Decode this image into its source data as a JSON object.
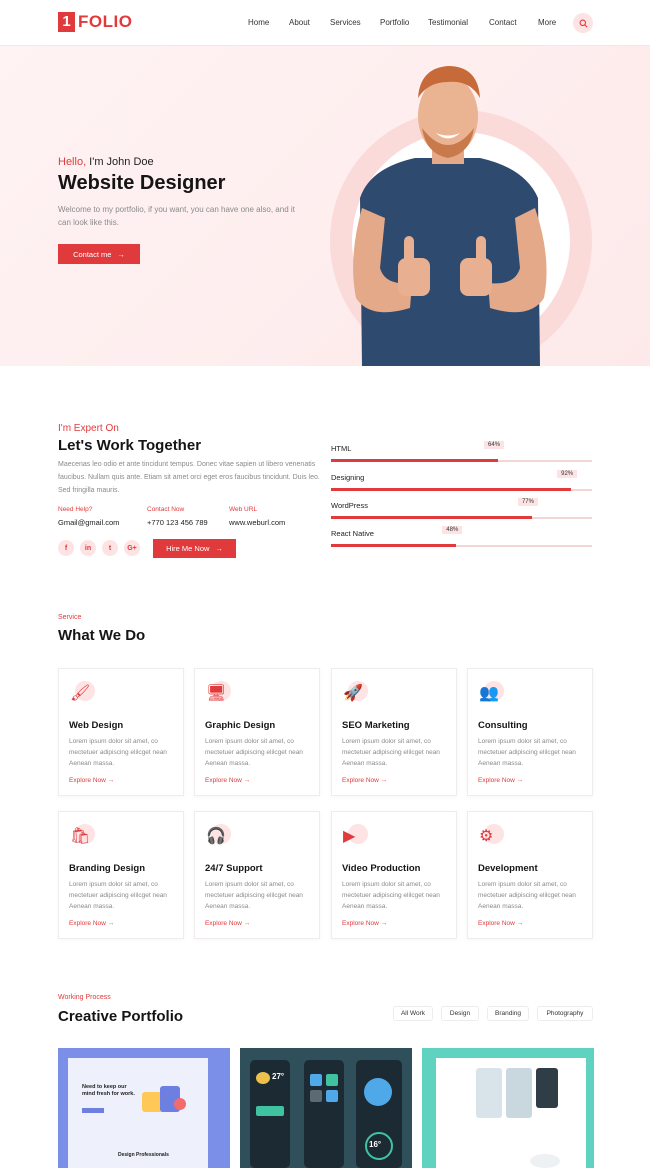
{
  "header": {
    "logo_mark": "1",
    "logo_text": "FOLIO",
    "nav": [
      "Home",
      "About",
      "Services",
      "Portfolio",
      "Testimonial",
      "Contact",
      "More"
    ]
  },
  "hero": {
    "hello_accent": "Hello,",
    "hello_rest": " I'm John Doe",
    "title": "Website Designer",
    "text": "Welcome to my portfolio, if you want, you can have one also, and it can look like this.",
    "cta": "Contact me"
  },
  "expert": {
    "small": "I'm Expert On",
    "title": "Let's Work Together",
    "text": "Maecenas leo odio et ante tincidunt tempus. Donec vitae sapien ut libero venenatis faucibus. Nullam quis ante. Etiam sit amet orci eget eros faucibus tincidunt. Duis leo. Sed fringilla mauris.",
    "contacts": [
      {
        "label": "Need Help?",
        "value": "Gmail@gmail.com"
      },
      {
        "label": "Contact Now",
        "value": "+770 123 456 789"
      },
      {
        "label": "Web URL",
        "value": "www.weburl.com"
      }
    ],
    "social": [
      "f",
      "in",
      "t",
      "G+"
    ],
    "cta": "Hire Me Now",
    "skills": [
      {
        "name": "HTML",
        "percent": 64,
        "label": "64%"
      },
      {
        "name": "Designing",
        "percent": 92,
        "label": "92%"
      },
      {
        "name": "WordPress",
        "percent": 77,
        "label": "77%"
      },
      {
        "name": "React Native",
        "percent": 48,
        "label": "48%"
      }
    ]
  },
  "services": {
    "small": "Service",
    "title": "What We Do",
    "desc": "Lorem ipsum dolor sit amet, co mectetuer adipiscing elilcget nean Aenean massa.",
    "link": "Explore Now",
    "items": [
      {
        "title": "Web Design",
        "icon": "paint-roller-icon"
      },
      {
        "title": "Graphic Design",
        "icon": "design-monitor-icon"
      },
      {
        "title": "SEO Marketing",
        "icon": "rocket-icon"
      },
      {
        "title": "Consulting",
        "icon": "consulting-icon"
      },
      {
        "title": "Branding Design",
        "icon": "shopping-bag-icon"
      },
      {
        "title": "24/7 Support",
        "icon": "headset-icon"
      },
      {
        "title": "Video Production",
        "icon": "video-icon"
      },
      {
        "title": "Development",
        "icon": "code-gear-icon"
      }
    ]
  },
  "portfolio": {
    "small": "Working Process",
    "title": "Creative Portfolio",
    "filters": [
      "All Work",
      "Design",
      "Branding",
      "Photography"
    ],
    "thumb1_heading": "Need to keep our mind fresh for work.",
    "thumb1_footer": "Design Professionals",
    "thumb2_temp": "27°",
    "thumb2_dial": "16°"
  },
  "colors": {
    "accent": "#e03a3c",
    "accent_light": "#fde3e3"
  }
}
